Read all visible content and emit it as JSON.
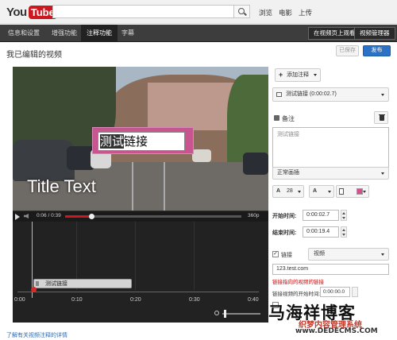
{
  "brand": {
    "you": "You",
    "tube": "Tube"
  },
  "search": {
    "value": "",
    "placeholder": ""
  },
  "top_links": [
    "浏览",
    "电影",
    "上传"
  ],
  "nav": {
    "tabs": [
      {
        "label": "信息和设置",
        "active": false
      },
      {
        "label": "增强功能",
        "active": false
      },
      {
        "label": "注释功能",
        "active": true
      },
      {
        "label": "字幕",
        "active": false
      }
    ],
    "view_on_page": "在视频页上观看",
    "video_manager": "视频管理器"
  },
  "page": {
    "title": "我已编辑的视频",
    "saved_label": "已保存",
    "publish_label": "发布"
  },
  "video": {
    "annotation_text_hl": "测试",
    "annotation_text_rest": "链接",
    "title_text": "Title Text",
    "time": "0:06 / 0:39",
    "quality": "360p",
    "progress": 0.15,
    "progress_color": "#cc181e"
  },
  "timeline": {
    "bar_label": "测试链接",
    "ticks": [
      "0:00",
      "0:10",
      "0:20",
      "0:30",
      "0:40"
    ]
  },
  "learn_link": "了解有关视频注释的详情",
  "panel": {
    "add_label": "添加注释",
    "annotation_select": "测试链接 (0:00:02.7)",
    "note_label": "备注",
    "note_text": "测试链接",
    "style_select": "正常画插",
    "font_size": "28",
    "text_color_label": "A",
    "start_label": "开始时间:",
    "start_value": "0:00:02.7",
    "end_label": "结束时间:",
    "end_value": "0:00:19.4",
    "link_label": "链接",
    "link_check": "✓",
    "link_type": "视频",
    "link_url": "123.test.com",
    "error": "链接指向的视频的链接",
    "link_start_label": "链接视频的开始时间:",
    "link_start_value": "0:00:00.0",
    "accent_swatch": "#d7508e"
  },
  "watermark": {
    "main": "马海祥博客",
    "sub": "织梦内容管理系统",
    "url": "www.DEDECMS.COM"
  }
}
